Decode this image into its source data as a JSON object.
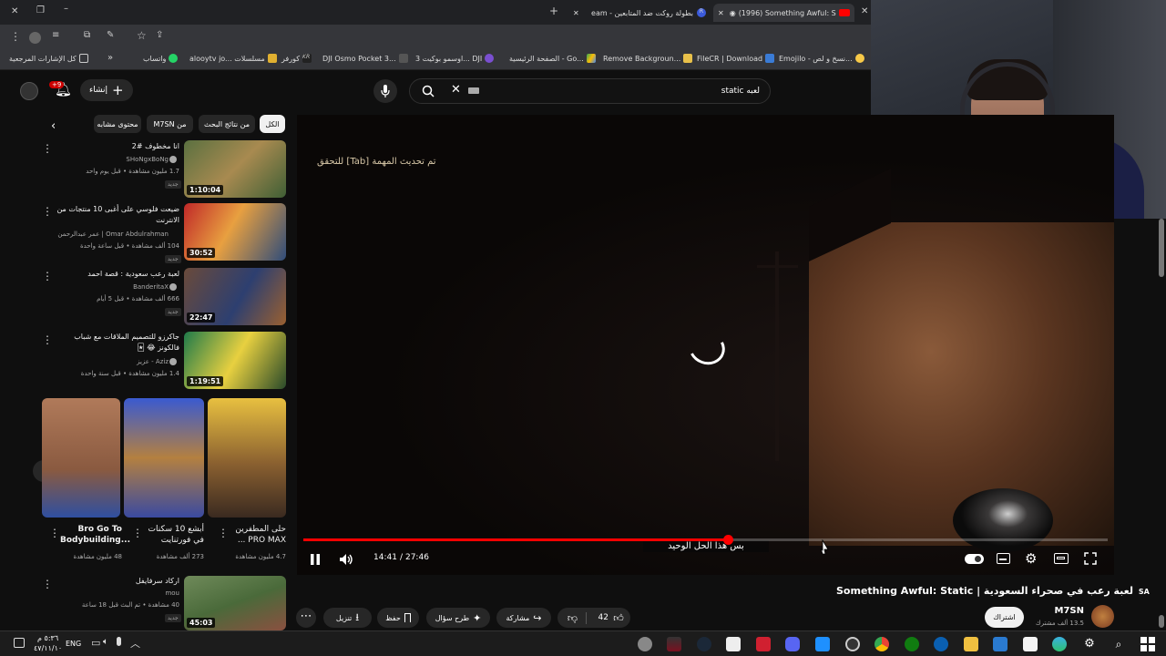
{
  "browser": {
    "tabs": [
      {
        "label": "(1996) Something Awful: St",
        "active": true
      },
      {
        "label": "بطولة روكت ضد المتابعين - eam",
        "active": false
      }
    ],
    "bookmarks": [
      "كل الإشارات المرجعية",
      "واتساب",
      "alooytv jo... مسلسلات",
      "كورفر",
      "DJI Osmo Pocket 3...",
      "اوسمو بوكيت 3... DJI",
      "الصفحة الرئيسية - Go...",
      "Remove Backgroun...",
      "FileCR | Download",
      "Emojilo - نسخ و لص..."
    ]
  },
  "youtube": {
    "search_value": "لعبه static",
    "create_label": "إنشاء",
    "notif_count": "+9",
    "filters": [
      "الكل",
      "من نتائج البحث",
      "من M7SN",
      "محتوى مشابه"
    ],
    "video": {
      "hint_text": "تم تحديث المهمة [Tab] للتحقق",
      "subtitle": "بس هذا الحل الوحيد",
      "time_current": "14:41",
      "time_total": "27:46",
      "progress": 0.528,
      "title": "لعبة رعب في صحراء السعودية | Something Awful: Static",
      "title_badge": "SA",
      "channel": "M7SN",
      "subs": "13.5 ألف مشترك",
      "subscribe": "اشتراك",
      "likes": "42",
      "share": "مشاركة",
      "ask": "طرح سؤال",
      "save": "حفظ",
      "download": "تنزيل"
    },
    "related": [
      {
        "title": "انا مخطوف #2",
        "channel": "SHoNgxBoNg",
        "meta": "1.7 مليون مشاهدة • قبل يوم واحد",
        "badge": "جديد",
        "duration": "1:10:04"
      },
      {
        "title": "ضيعت فلوسي على أغبى 10 منتجات من الانترنت",
        "channel": "Omar Abdulrahman | عمر عبدالرحمن",
        "meta": "104 ألف مشاهدة • قبل ساعة واحدة",
        "badge": "جديد",
        "duration": "30:52"
      },
      {
        "title": "لعبة رعب سعودية : قصة احمد",
        "channel": "BanderitaX",
        "meta": "666 ألف مشاهدة • قبل 5 أيام",
        "badge": "جديد",
        "duration": "22:47"
      },
      {
        "title": "جاكرزو للتصميم الملاقات مع شباب فالكونز 😂 🃏",
        "channel": "Aziz - عزيز",
        "meta": "1.4 مليون مشاهدة • قبل سنة واحدة",
        "badge": "",
        "duration": "1:19:51"
      },
      {
        "title": "اركاد سرفايفل",
        "channel": "mou",
        "meta": "40 مشاهدة • تم البث قبل 18 ساعة",
        "badge": "جديد",
        "duration": "45:03"
      }
    ],
    "shorts": [
      {
        "title": "حلى المطفرين PRO MAX ...",
        "views": "4.7 مليون مشاهدة"
      },
      {
        "title": "أبشع 10 سكنات في فورتنايت",
        "views": "273 ألف مشاهدة"
      },
      {
        "title": "Bro Go To Bodybuilding...",
        "views": "48 مليون مشاهدة"
      }
    ]
  },
  "taskbar": {
    "lang": "ENG",
    "time": "٥:٣٦ م",
    "date": "٤٧/١١/١٠"
  }
}
